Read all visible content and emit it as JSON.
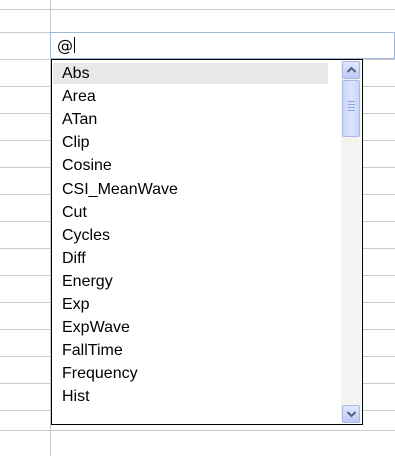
{
  "edit": {
    "value": "@"
  },
  "dropdown": {
    "items": [
      {
        "label": "Abs",
        "selected": true
      },
      {
        "label": "Area"
      },
      {
        "label": "ATan"
      },
      {
        "label": "Clip"
      },
      {
        "label": "Cosine"
      },
      {
        "label": "CSI_MeanWave"
      },
      {
        "label": "Cut"
      },
      {
        "label": "Cycles"
      },
      {
        "label": "Diff"
      },
      {
        "label": "Energy"
      },
      {
        "label": "Exp"
      },
      {
        "label": "ExpWave"
      },
      {
        "label": "FallTime"
      },
      {
        "label": "Frequency"
      },
      {
        "label": "Hist"
      }
    ],
    "scrollbar": {
      "up_icon": "arrow-up-icon",
      "down_icon": "arrow-down-icon"
    }
  },
  "colors": {
    "selection": "#e8e8e8",
    "scroll_button": "#c7d5fb",
    "grid": "#c9c9c9"
  }
}
